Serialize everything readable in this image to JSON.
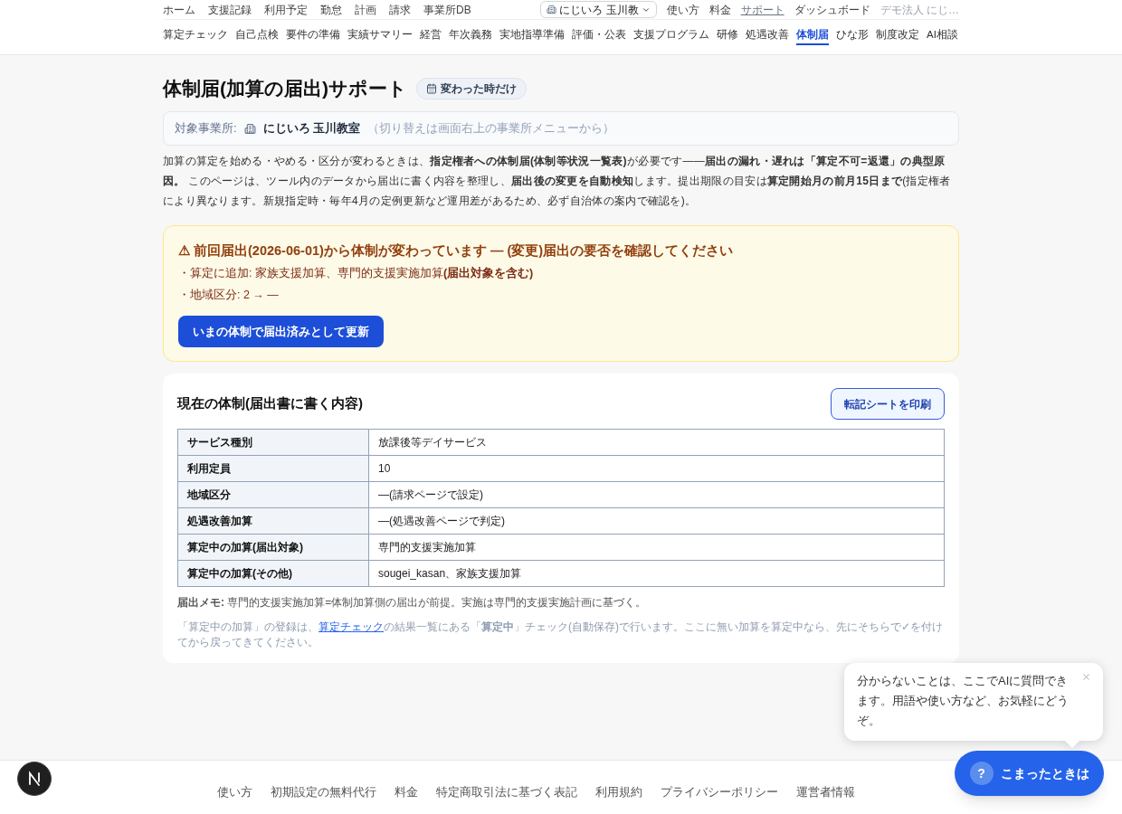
{
  "header": {
    "top_nav": {
      "items": [
        "ホーム",
        "支援記録",
        "利用予定",
        "勤怠",
        "計画",
        "請求",
        "事業所DB"
      ],
      "office_selector": "にじいろ 玉川教",
      "links": [
        {
          "label": "使い方",
          "underlined": false
        },
        {
          "label": "料金",
          "underlined": false
        },
        {
          "label": "サポート",
          "underlined": true
        },
        {
          "label": "ダッシュボード",
          "underlined": false
        }
      ],
      "account": "デモ法人 にじ…"
    },
    "nav_tabs": [
      {
        "label": "算定チェック",
        "selected": false
      },
      {
        "label": "自己点検",
        "selected": false
      },
      {
        "label": "要件の準備",
        "selected": false
      },
      {
        "label": "実績サマリー",
        "selected": false
      },
      {
        "label": "経営",
        "selected": false
      },
      {
        "label": "年次義務",
        "selected": false
      },
      {
        "label": "実地指導準備",
        "selected": false
      },
      {
        "label": "評価・公表",
        "selected": false
      },
      {
        "label": "支援プログラム",
        "selected": false
      },
      {
        "label": "研修",
        "selected": false
      },
      {
        "label": "処遇改善",
        "selected": false
      },
      {
        "label": "体制届",
        "selected": true
      },
      {
        "label": "ひな形",
        "selected": false
      },
      {
        "label": "制度改定",
        "selected": false
      },
      {
        "label": "AI相談",
        "selected": false
      }
    ]
  },
  "page": {
    "title": "体制届(加算の届出)サポート",
    "badge": "変わった時だけ",
    "office": {
      "label": "対象事業所:",
      "name": "にじいろ 玉川教室",
      "hint": "（切り替えは画面右上の事業所メニューから）"
    },
    "description": "加算の算定を始める・やめる・区分が変わるときは、**指定権者への体制届(体制等状況一覧表)**が必要です——**届出の漏れ・遅れは「算定不可=返還」の典型原因。** このページは、ツール内のデータから届出に書く内容を整理し、**届出後の変更を自動検知**します。提出期限の目安は**算定開始月の前月15日まで**(指定権者により異なります。新規指定時・毎年4月の定例更新など運用差があるため、必ず自治体の案内で確認を)。",
    "change_alert": {
      "title": "⚠ 前回届出(2026-06-01)から体制が変わっています — (変更)届出の要否を確認してください",
      "lines": [
        "・算定に追加: 家族支援加算、専門的支援実施加算**(届出対象を含む)**",
        "・地域区分: 2 → —"
      ],
      "button": "いまの体制で届出済みとして更新"
    },
    "current_setup": {
      "title": "現在の体制(届出書に書く内容)",
      "print_button": "転記シートを印刷",
      "rows": [
        {
          "label": "サービス種別",
          "value": "放課後等デイサービス"
        },
        {
          "label": "利用定員",
          "value": "10"
        },
        {
          "label": "地域区分",
          "value": "—(請求ページで設定)"
        },
        {
          "label": "処遇改善加算",
          "value": "—(処遇改善ページで判定)"
        },
        {
          "label": "算定中の加算(届出対象)",
          "value": "専門的支援実施加算"
        },
        {
          "label": "算定中の加算(その他)",
          "value": "sougei_kasan、家族支援加算"
        }
      ],
      "memo": "**届出メモ:** 専門的支援実施加算=体制加算側の届出が前提。実施は専門的支援実施計画に基づく。",
      "note": {
        "before": "「算定中の加算」の登録は、",
        "link": "算定チェック",
        "after": "の結果一覧にある「**算定中**」チェック(自動保存)で行います。ここに無い加算を算定中なら、先にそちらで✓を付けてから戻ってきてください。"
      }
    }
  },
  "footer": {
    "links": [
      "使い方",
      "初期設定の無料代行",
      "料金",
      "特定商取引法に基づく表記",
      "利用規約",
      "プライバシーポリシー",
      "運営者情報"
    ]
  },
  "help_widget": {
    "tooltip": "分からないことは、ここでAIに質問できます。用語や使い方など、お気軽にどうぞ。",
    "button_mark": "?",
    "button": "こまったときは"
  }
}
